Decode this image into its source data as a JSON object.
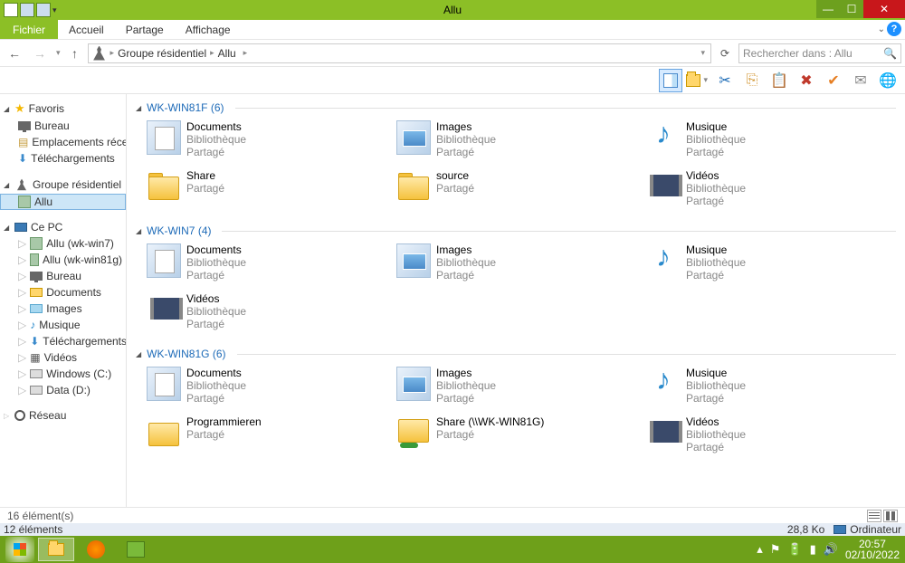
{
  "window_title": "Allu",
  "menubar": {
    "file": "Fichier",
    "home": "Accueil",
    "share": "Partage",
    "view": "Affichage"
  },
  "breadcrumb": {
    "root": "Groupe résidentiel",
    "leaf": "Allu"
  },
  "search_placeholder": "Rechercher dans : Allu",
  "sidebar": {
    "favoris": {
      "label": "Favoris",
      "items": [
        "Bureau",
        "Emplacements récen",
        "Téléchargements"
      ]
    },
    "groupe": {
      "label": "Groupe résidentiel",
      "items": [
        "Allu"
      ]
    },
    "cepc": {
      "label": "Ce PC",
      "items": [
        "Allu (wk-win7)",
        "Allu (wk-win81g)",
        "Bureau",
        "Documents",
        "Images",
        "Musique",
        "Téléchargements",
        "Vidéos",
        "Windows (C:)",
        "Data (D:)"
      ]
    },
    "reseau": {
      "label": "Réseau"
    }
  },
  "lib_label": "Bibliothèque",
  "shared_label": "Partagé",
  "groups": [
    {
      "header": "WK-WIN81F (6)",
      "items": [
        {
          "name": "Documents",
          "sub1": "Bibliothèque",
          "sub2": "Partagé",
          "icon": "doc"
        },
        {
          "name": "Images",
          "sub1": "Bibliothèque",
          "sub2": "Partagé",
          "icon": "img"
        },
        {
          "name": "Musique",
          "sub1": "Bibliothèque",
          "sub2": "Partagé",
          "icon": "music"
        },
        {
          "name": "Share",
          "sub1": "Partagé",
          "sub2": "",
          "icon": "folder"
        },
        {
          "name": "source",
          "sub1": "Partagé",
          "sub2": "",
          "icon": "folder"
        },
        {
          "name": "Vidéos",
          "sub1": "Bibliothèque",
          "sub2": "Partagé",
          "icon": "video"
        }
      ]
    },
    {
      "header": "WK-WIN7 (4)",
      "items": [
        {
          "name": "Documents",
          "sub1": "Bibliothèque",
          "sub2": "Partagé",
          "icon": "doc"
        },
        {
          "name": "Images",
          "sub1": "Bibliothèque",
          "sub2": "Partagé",
          "icon": "img"
        },
        {
          "name": "Musique",
          "sub1": "Bibliothèque",
          "sub2": "Partagé",
          "icon": "music"
        },
        {
          "name": "Vidéos",
          "sub1": "Bibliothèque",
          "sub2": "Partagé",
          "icon": "video"
        }
      ]
    },
    {
      "header": "WK-WIN81G (6)",
      "items": [
        {
          "name": "Documents",
          "sub1": "Bibliothèque",
          "sub2": "Partagé",
          "icon": "doc"
        },
        {
          "name": "Images",
          "sub1": "Bibliothèque",
          "sub2": "Partagé",
          "icon": "img"
        },
        {
          "name": "Musique",
          "sub1": "Bibliothèque",
          "sub2": "Partagé",
          "icon": "music"
        },
        {
          "name": "Programmieren",
          "sub1": "Partagé",
          "sub2": "",
          "icon": "prog"
        },
        {
          "name": "Share (\\\\WK-WIN81G)",
          "sub1": "Partagé",
          "sub2": "",
          "icon": "netfolder"
        },
        {
          "name": "Vidéos",
          "sub1": "Bibliothèque",
          "sub2": "Partagé",
          "icon": "video"
        }
      ]
    }
  ],
  "footer": {
    "count_text": "16 élément(s)",
    "selection_text": "12 éléments",
    "size_text": "28,8 Ko",
    "computer_label": "Ordinateur"
  },
  "clock": {
    "time": "20:57",
    "date": "02/10/2022"
  }
}
